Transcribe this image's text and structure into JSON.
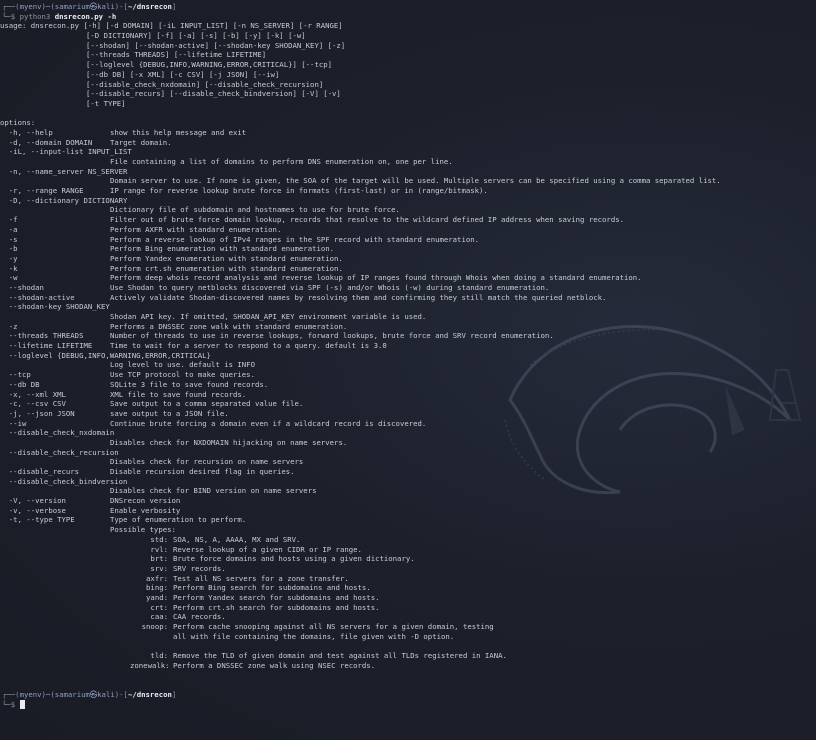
{
  "colors": {
    "background": "#1b1e28",
    "text": "#c9ccd3",
    "prompt": "#8a93a8",
    "path": "#e8ebf2"
  },
  "prompt": {
    "line1_prefix": "┌──(",
    "context": "myenv)─(samarium㉿kali",
    "line1_mid": ")-[",
    "path": "~/dnsrecon",
    "line1_suffix": "]",
    "line2_prefix": "└─$ ",
    "pre_command": "python3 ",
    "command": "dnsrecon.py -h"
  },
  "output": [
    {
      "c": [
        "usage: dnsrecon.py [-h] [-d DOMAIN] [-iL INPUT_LIST] [-n NS_SERVER] [-r RANGE]"
      ]
    },
    {
      "c": [
        "",
        "[-D DICTIONARY] [-f] [-a] [-s] [-b] [-y] [-k] [-w]"
      ]
    },
    {
      "c": [
        "",
        "[--shodan] [--shodan-active] [--shodan-key SHODAN_KEY] [-z]"
      ]
    },
    {
      "c": [
        "",
        "[--threads THREADS] [--lifetime LIFETIME]"
      ]
    },
    {
      "c": [
        "",
        "[--loglevel {DEBUG,INFO,WARNING,ERROR,CRITICAL}] [--tcp]"
      ]
    },
    {
      "c": [
        "",
        "[--db DB] [-x XML] [-c CSV] [-j JSON] [--iw]"
      ]
    },
    {
      "c": [
        "",
        "[--disable_check_nxdomain] [--disable_check_recursion]"
      ]
    },
    {
      "c": [
        "",
        "[--disable_recurs] [--disable_check_bindversion] [-V] [-v]"
      ]
    },
    {
      "c": [
        "",
        "[-t TYPE]"
      ]
    },
    {
      "c": [
        ""
      ]
    },
    {
      "c": [
        "options:"
      ]
    },
    {
      "c": [
        "  -h, --help",
        "show this help message and exit"
      ]
    },
    {
      "c": [
        "  -d, --domain DOMAIN",
        "Target domain."
      ]
    },
    {
      "c": [
        "  -iL, --input-list INPUT_LIST"
      ]
    },
    {
      "c": [
        "",
        "File containing a list of domains to perform DNS enumeration on, one per line."
      ]
    },
    {
      "c": [
        "  -n, --name_server NS_SERVER"
      ]
    },
    {
      "c": [
        "",
        "Domain server to use. If none is given, the SOA of the target will be used. Multiple servers can be specified using a comma separated list."
      ]
    },
    {
      "c": [
        "  -r, --range RANGE",
        "IP range for reverse lookup brute force in formats (first-last) or in (range/bitmask)."
      ]
    },
    {
      "c": [
        "  -D, --dictionary DICTIONARY"
      ]
    },
    {
      "c": [
        "",
        "Dictionary file of subdomain and hostnames to use for brute force."
      ]
    },
    {
      "c": [
        "  -f",
        "Filter out of brute force domain lookup, records that resolve to the wildcard defined IP address when saving records."
      ]
    },
    {
      "c": [
        "  -a",
        "Perform AXFR with standard enumeration."
      ]
    },
    {
      "c": [
        "  -s",
        "Perform a reverse lookup of IPv4 ranges in the SPF record with standard enumeration."
      ]
    },
    {
      "c": [
        "  -b",
        "Perform Bing enumeration with standard enumeration."
      ]
    },
    {
      "c": [
        "  -y",
        "Perform Yandex enumeration with standard enumeration."
      ]
    },
    {
      "c": [
        "  -k",
        "Perform crt.sh enumeration with standard enumeration."
      ]
    },
    {
      "c": [
        "  -w",
        "Perform deep whois record analysis and reverse lookup of IP ranges found through Whois when doing a standard enumeration."
      ]
    },
    {
      "c": [
        "  --shodan",
        "Use Shodan to query netblocks discovered via SPF (-s) and/or Whois (-w) during standard enumeration."
      ]
    },
    {
      "c": [
        "  --shodan-active",
        "Actively validate Shodan-discovered names by resolving them and confirming they still match the queried netblock."
      ]
    },
    {
      "c": [
        "  --shodan-key SHODAN_KEY"
      ]
    },
    {
      "c": [
        "",
        "Shodan API key. If omitted, SHODAN_API_KEY environment variable is used."
      ]
    },
    {
      "c": [
        "  -z",
        "Performs a DNSSEC zone walk with standard enumeration."
      ]
    },
    {
      "c": [
        "  --threads THREADS",
        "Number of threads to use in reverse lookups, forward lookups, brute force and SRV record enumeration."
      ]
    },
    {
      "c": [
        "  --lifetime LIFETIME",
        "Time to wait for a server to respond to a query. default is 3.0"
      ]
    },
    {
      "c": [
        "  --loglevel {DEBUG,INFO,WARNING,ERROR,CRITICAL}"
      ]
    },
    {
      "c": [
        "",
        "Log level to use. default is INFO"
      ]
    },
    {
      "c": [
        "  --tcp",
        "Use TCP protocol to make queries."
      ]
    },
    {
      "c": [
        "  --db DB",
        "SQLite 3 file to save found records."
      ]
    },
    {
      "c": [
        "  -x, --xml XML",
        "XML file to save found records."
      ]
    },
    {
      "c": [
        "  -c, --csv CSV",
        "Save output to a comma separated value file."
      ]
    },
    {
      "c": [
        "  -j, --json JSON",
        "save output to a JSON file."
      ]
    },
    {
      "c": [
        "  --iw",
        "Continue brute forcing a domain even if a wildcard record is discovered."
      ]
    },
    {
      "c": [
        "  --disable_check_nxdomain"
      ]
    },
    {
      "c": [
        "",
        "Disables check for NXDOMAIN hijacking on name servers."
      ]
    },
    {
      "c": [
        "  --disable_check_recursion"
      ]
    },
    {
      "c": [
        "",
        "Disables check for recursion on name servers"
      ]
    },
    {
      "c": [
        "  --disable_recurs",
        "Disable recursion desired flag in queries."
      ]
    },
    {
      "c": [
        "  --disable_check_bindversion"
      ]
    },
    {
      "c": [
        "",
        "Disables check for BIND version on name servers"
      ]
    },
    {
      "c": [
        "  -V, --version",
        "DNSrecon version"
      ]
    },
    {
      "c": [
        "  -v, --verbose",
        "Enable verbosity"
      ]
    },
    {
      "c": [
        "  -t, --type TYPE",
        "Type of enumeration to perform."
      ]
    },
    {
      "c": [
        "",
        "Possible types:"
      ]
    },
    {
      "t": [
        "std:",
        "SOA, NS, A, AAAA, MX and SRV."
      ]
    },
    {
      "t": [
        "rvl:",
        "Reverse lookup of a given CIDR or IP range."
      ]
    },
    {
      "t": [
        "brt:",
        "Brute force domains and hosts using a given dictionary."
      ]
    },
    {
      "t": [
        "srv:",
        "SRV records."
      ]
    },
    {
      "t": [
        "axfr:",
        "Test all NS servers for a zone transfer."
      ]
    },
    {
      "t": [
        "bing:",
        "Perform Bing search for subdomains and hosts."
      ]
    },
    {
      "t": [
        "yand:",
        "Perform Yandex search for subdomains and hosts."
      ]
    },
    {
      "t": [
        "crt:",
        "Perform crt.sh search for subdomains and hosts."
      ]
    },
    {
      "t": [
        "caa:",
        "CAA records."
      ]
    },
    {
      "t": [
        "snoop:",
        "Perform cache snooping against all NS servers for a given domain, testing"
      ]
    },
    {
      "t": [
        "",
        "all with file containing the domains, file given with -D option."
      ]
    },
    {
      "t": [
        ""
      ]
    },
    {
      "t": [
        "tld:",
        "Remove the TLD of given domain and test against all TLDs registered in IANA."
      ]
    },
    {
      "t": [
        "zonewalk:",
        "Perform a DNSSEC zone walk using NSEC records."
      ]
    },
    {
      "c": [
        ""
      ]
    },
    {
      "c": [
        ""
      ]
    }
  ],
  "watermark_icon": "kali-dragon-logo"
}
